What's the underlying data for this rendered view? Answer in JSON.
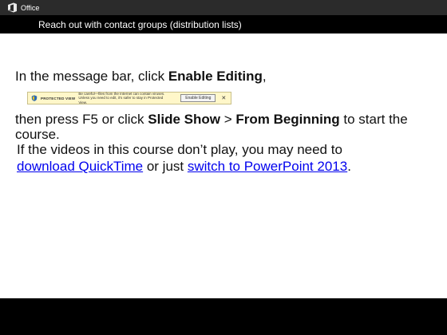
{
  "brand": {
    "name": "Office",
    "icon": "office-logo-icon"
  },
  "course_title": "Reach out with contact groups (distribution lists)",
  "step1": {
    "prefix": "In the message bar, click ",
    "bold": "Enable Editing",
    "suffix": ","
  },
  "message_bar": {
    "icon": "shield-icon",
    "label": "PROTECTED VIEW",
    "text": "Be careful—files from the Internet can contain viruses. Unless you need to edit, it's safer to stay in Protected View.",
    "button": "Enable Editing",
    "close": "✕"
  },
  "step2": {
    "prefix": "then press F5 or click ",
    "bold1": "Slide Show",
    "sep": " > ",
    "bold2": "From Beginning",
    "suffix": " to start the course."
  },
  "note": {
    "prefix": "If the videos in this course don’t play, you may need to ",
    "link1": "download QuickTime",
    "middle": " or just ",
    "link2": "switch to PowerPoint 2013",
    "suffix": "."
  },
  "colors": {
    "topbar": "#2b2b2b",
    "titlebar": "#000000",
    "link": "#0000ee",
    "office_logo": "#e8e8e8"
  }
}
